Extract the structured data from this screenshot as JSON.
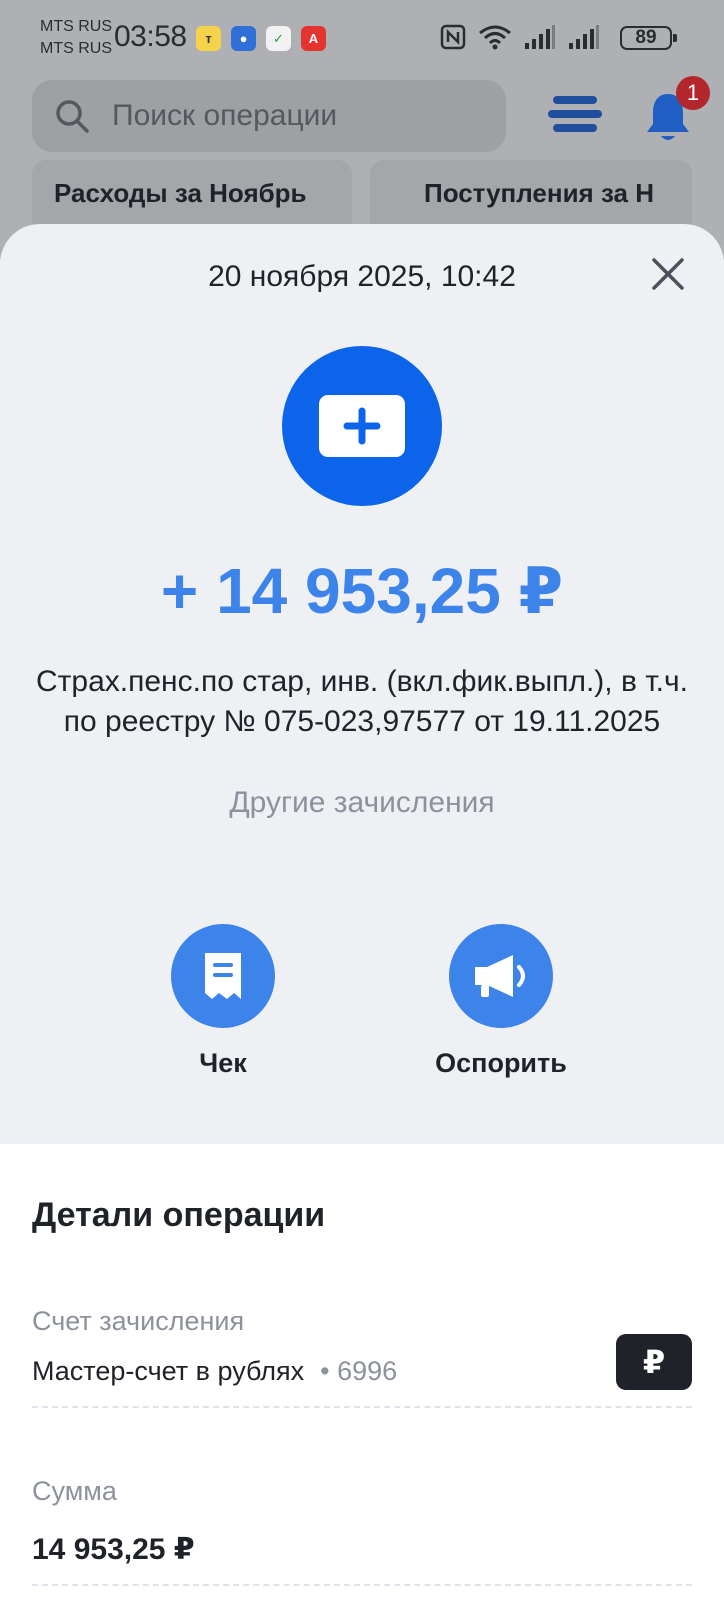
{
  "status_bar": {
    "carrier_1": "MTS RUS",
    "carrier_2": "MTS RUS",
    "time": "03:58",
    "battery": "89",
    "app_icons": [
      {
        "name": "tbank-icon",
        "glyph": "т",
        "bg": "#f4d34a",
        "fg": "#333333"
      },
      {
        "name": "wallet-icon",
        "glyph": "●",
        "bg": "#2f6fd6",
        "fg": "#ffffff"
      },
      {
        "name": "sber-icon",
        "glyph": "✓",
        "bg": "#f2f2f2",
        "fg": "#21a038"
      },
      {
        "name": "alfa-icon",
        "glyph": "А",
        "bg": "#e3342f",
        "fg": "#ffffff"
      }
    ]
  },
  "header": {
    "search_placeholder": "Поиск операции",
    "notification_count": "1"
  },
  "cards": {
    "expenses": "Расходы за Ноябрь",
    "income": "Поступления за Н"
  },
  "operation": {
    "datetime": "20 ноября 2025, 10:42",
    "amount": "+ 14 953,25 ₽",
    "description": "Страх.пенс.по стар, инв. (вкл.фик.выпл.), в т.ч. по реестру № 075-023,97577 от 19.11.2025",
    "category": "Другие зачисления",
    "actions": {
      "receipt": "Чек",
      "dispute": "Оспорить"
    }
  },
  "details": {
    "title": "Детали операции",
    "account_label": "Счет зачисления",
    "account_value": "Мастер-счет в рублях",
    "account_suffix": "• 6996",
    "currency_symbol": "₽",
    "sum_label": "Сумма",
    "sum_value": "14 953,25 ₽"
  },
  "colors": {
    "accent": "#3d84ea",
    "icon_circle": "#0b64ea",
    "sheet_bg": "#eef0f4"
  }
}
